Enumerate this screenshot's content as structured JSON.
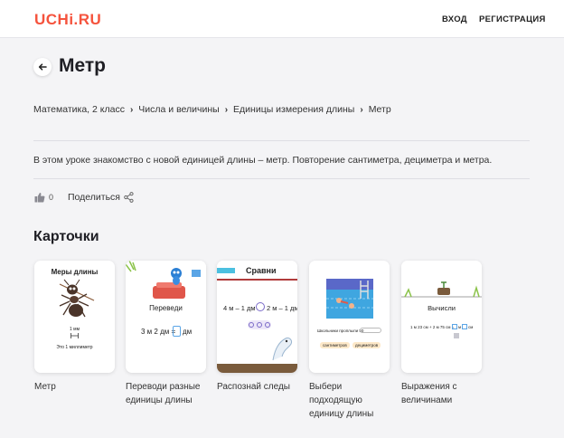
{
  "header": {
    "logo": "UCHi.RU",
    "login": "ВХОД",
    "register": "РЕГИСТРАЦИЯ"
  },
  "page": {
    "title": "Метр",
    "breadcrumb": [
      "Математика, 2 класс",
      "Числа и величины",
      "Единицы измерения длины",
      "Метр"
    ],
    "description": "В этом уроке знакомство с новой единицей длины – метр. Повторение сантиметра, дециметра и метра.",
    "likes_count": "0",
    "share_label": "Поделиться"
  },
  "cards_section": {
    "title": "Карточки",
    "cards": [
      {
        "label": "Метр",
        "preview_title": "Меры длины",
        "preview_lines": [
          "1 мм",
          "Это 1 миллиметр"
        ]
      },
      {
        "label": "Переводи разные единицы длины",
        "preview_title": "Переведи",
        "preview_lines": [
          "3 м 2 дм =",
          "дм"
        ]
      },
      {
        "label": "Распознай следы",
        "preview_title": "Сравни",
        "preview_lines": [
          "4 м – 1 дм",
          "2 м – 1 дм"
        ]
      },
      {
        "label": "Выбери подходящую единицу длины",
        "preview_title": "",
        "preview_lines": [
          "Школьники проплыли 50",
          "сантиметров",
          "дециметров"
        ]
      },
      {
        "label": "Выражения с величинами",
        "preview_title": "Вычисли",
        "preview_lines": [
          "1 м 23 см + 2 м 75 см =",
          "м",
          "см"
        ]
      }
    ]
  },
  "colors": {
    "logo": "#f5533d",
    "background": "#f4f4f6",
    "card_background": "#ffffff"
  }
}
